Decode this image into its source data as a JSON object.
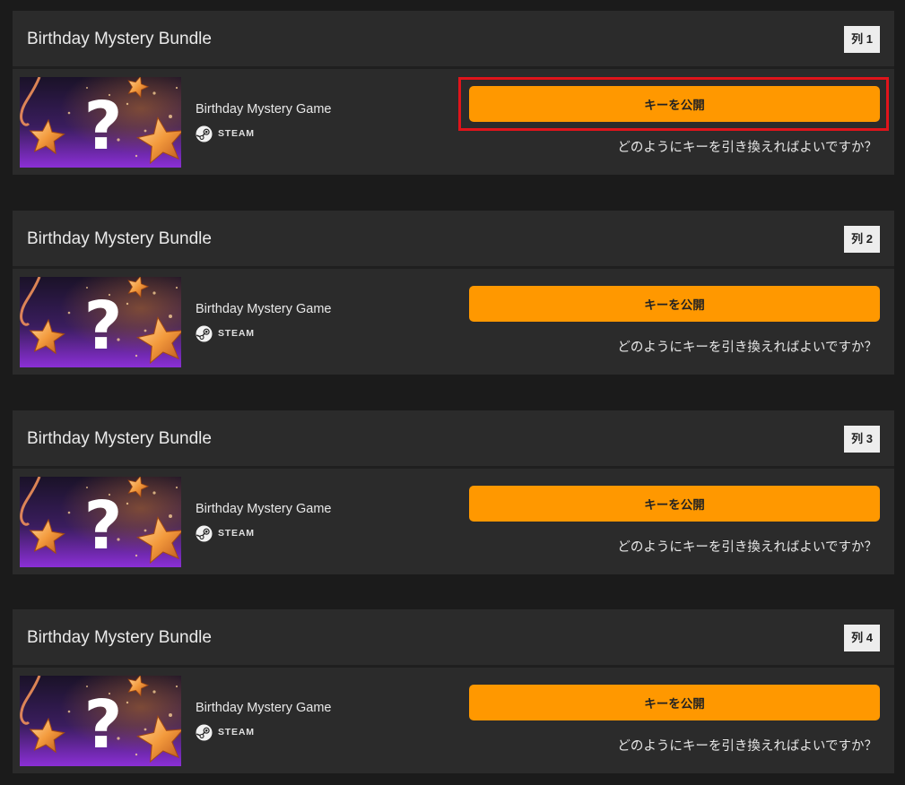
{
  "bundles": [
    {
      "title": "Birthday Mystery Bundle",
      "row_badge": "列 1",
      "game_name": "Birthday Mystery Game",
      "platform": "STEAM",
      "reveal_label": "キーを公開",
      "help_text": "どのようにキーを引き換えればよいですか？",
      "highlighted": true
    },
    {
      "title": "Birthday Mystery Bundle",
      "row_badge": "列 2",
      "game_name": "Birthday Mystery Game",
      "platform": "STEAM",
      "reveal_label": "キーを公開",
      "help_text": "どのようにキーを引き換えればよいですか？",
      "highlighted": false
    },
    {
      "title": "Birthday Mystery Bundle",
      "row_badge": "列 3",
      "game_name": "Birthday Mystery Game",
      "platform": "STEAM",
      "reveal_label": "キーを公開",
      "help_text": "どのようにキーを引き換えればよいですか？",
      "highlighted": false
    },
    {
      "title": "Birthday Mystery Bundle",
      "row_badge": "列 4",
      "game_name": "Birthday Mystery Game",
      "platform": "STEAM",
      "reveal_label": "キーを公開",
      "help_text": "どのようにキーを引き換えればよいですか？",
      "highlighted": false
    }
  ],
  "icons": {
    "platform_icon": "steam-icon",
    "thumbnail_icon": "question-mark-icon"
  },
  "colors": {
    "page_background": "#1b1b1b",
    "panel_background": "#2b2b2b",
    "accent_button": "#ff9800",
    "highlight": "#e0141b",
    "badge_background": "#ededed"
  }
}
